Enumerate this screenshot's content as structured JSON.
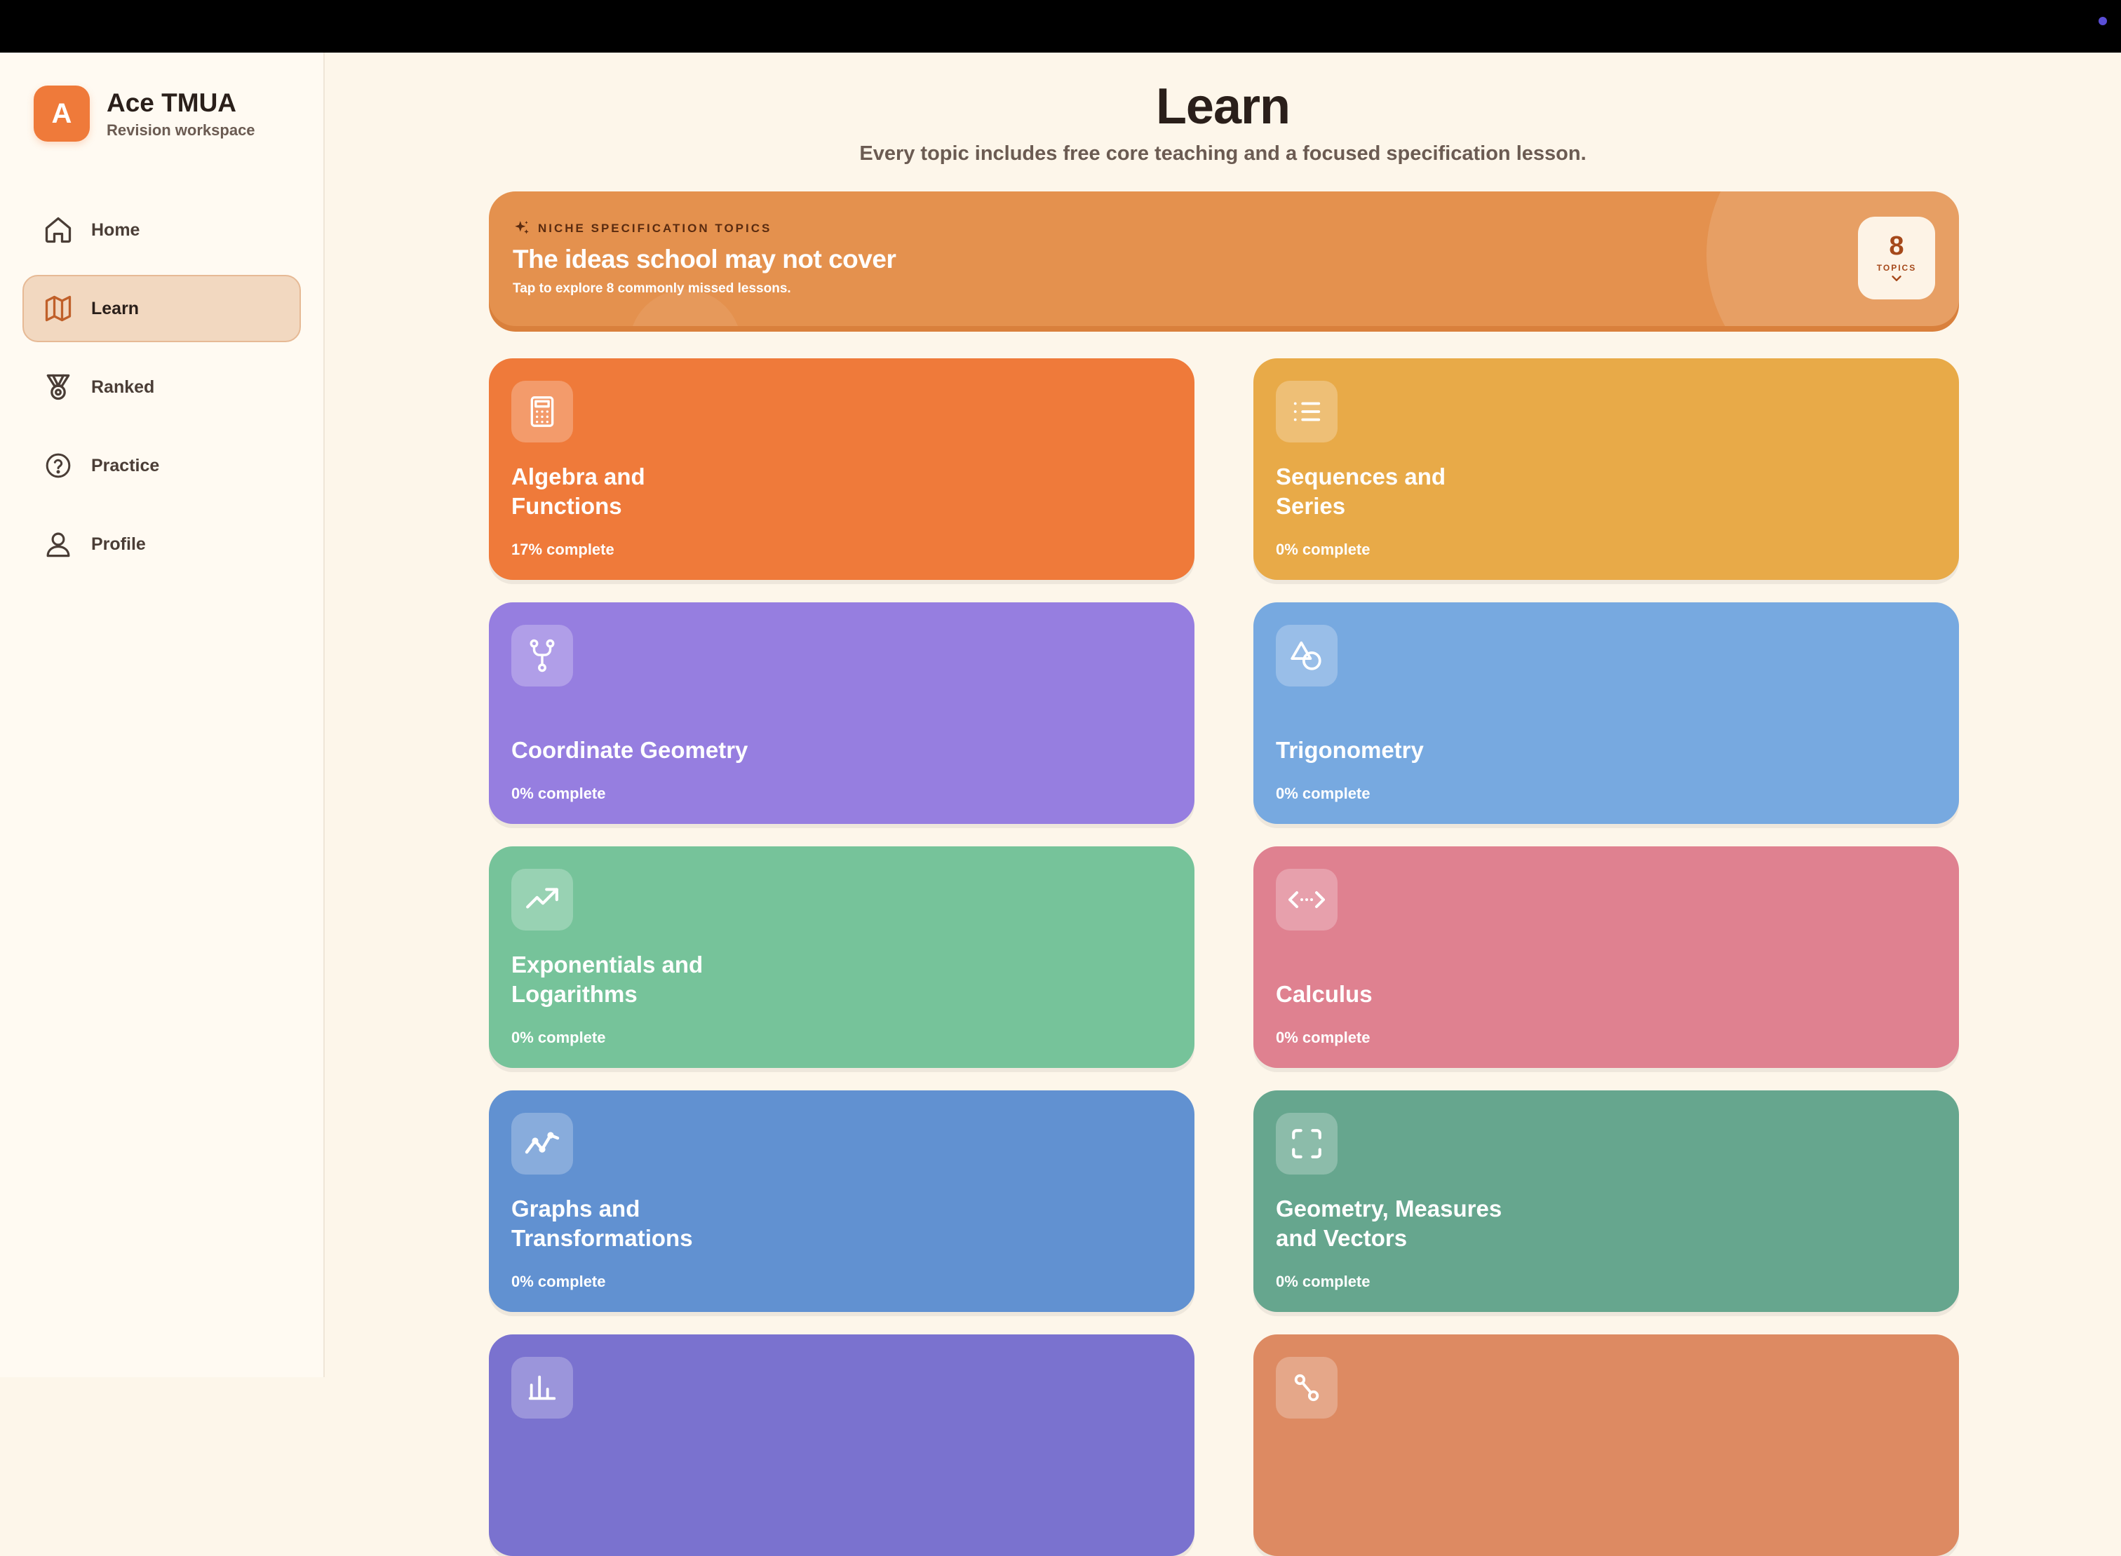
{
  "app": {
    "logo_letter": "A",
    "title": "Ace TMUA",
    "subtitle": "Revision workspace"
  },
  "nav": {
    "items": [
      {
        "label": "Home",
        "icon": "home-icon",
        "active": false
      },
      {
        "label": "Learn",
        "icon": "map-icon",
        "active": true
      },
      {
        "label": "Ranked",
        "icon": "medal-icon",
        "active": false
      },
      {
        "label": "Practice",
        "icon": "question-circle-icon",
        "active": false
      },
      {
        "label": "Profile",
        "icon": "user-icon",
        "active": false
      }
    ]
  },
  "page": {
    "title": "Learn",
    "subtitle": "Every topic includes free core teaching and a focused specification lesson."
  },
  "banner": {
    "eyebrow": "NICHE SPECIFICATION TOPICS",
    "title": "The ideas school may not cover",
    "subtitle": "Tap to explore 8 commonly missed lessons.",
    "badge_count": "8",
    "badge_label": "TOPICS"
  },
  "topics": [
    {
      "title": "Algebra and Functions",
      "progress": "17% complete",
      "color": "#ef7a3a",
      "icon": "calculator-icon"
    },
    {
      "title": "Sequences and Series",
      "progress": "0% complete",
      "color": "#e8aa48",
      "icon": "list-icon"
    },
    {
      "title": "Coordinate Geometry",
      "progress": "0% complete",
      "color": "#967ee0",
      "icon": "fork-icon"
    },
    {
      "title": "Trigonometry",
      "progress": "0% complete",
      "color": "#77a9e0",
      "icon": "shapes-icon"
    },
    {
      "title": "Exponentials and Logarithms",
      "progress": "0% complete",
      "color": "#76c39a",
      "icon": "trending-up-icon"
    },
    {
      "title": "Calculus",
      "progress": "0% complete",
      "color": "#df8190",
      "icon": "arrows-horizontal-icon"
    },
    {
      "title": "Graphs and Transformations",
      "progress": "0% complete",
      "color": "#6191d1",
      "icon": "line-chart-icon"
    },
    {
      "title": "Geometry, Measures and Vectors",
      "progress": "0% complete",
      "color": "#66a68e",
      "icon": "scan-icon"
    },
    {
      "title": "",
      "progress": "",
      "color": "#7a72cf",
      "icon": "bar-chart-icon"
    },
    {
      "title": "",
      "progress": "",
      "color": "#dd8a62",
      "icon": "nodes-icon"
    }
  ]
}
